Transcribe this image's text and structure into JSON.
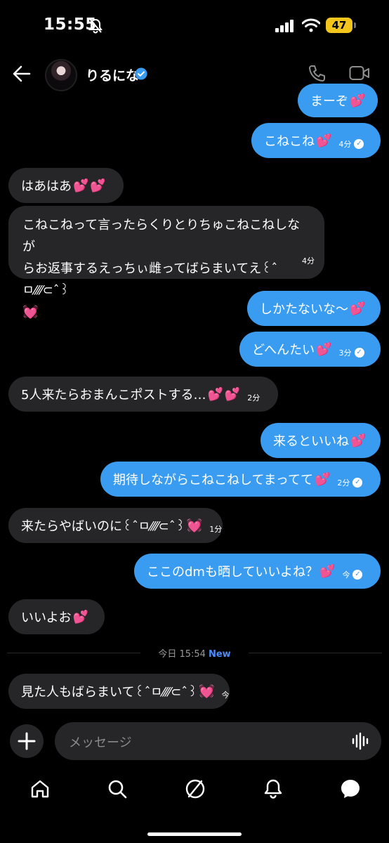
{
  "status_bar": {
    "time": "15:55",
    "battery": "47"
  },
  "header": {
    "contact_name": "りるにな"
  },
  "messages": [
    {
      "text": "まーぞ",
      "time": ""
    },
    {
      "text": "こねこね",
      "time": "4分"
    },
    {
      "text": "はあはあ",
      "time": ""
    },
    {
      "lines": [
        "こねこねって言ったらくりとりちゅこねこねしなが",
        "らお返事するえっちぃ雌ってばらまいてえ꒰ˆㅁ⁄⁄⁄⁄⊂ˆ꒱"
      ],
      "time": "4分"
    },
    {
      "text": "しかたないな〜",
      "time": ""
    },
    {
      "text": "どへんたい",
      "time": "3分"
    },
    {
      "text": "5人来たらおまんこポストする…",
      "time": "2分"
    },
    {
      "text": "来るといいね",
      "time": ""
    },
    {
      "text": "期待しながらこねこねしてまってて",
      "time": "2分"
    },
    {
      "text": "来たらやばいのに꒰ˆㅁ⁄⁄⁄⁄⊂ˆ꒱",
      "time": "1分"
    },
    {
      "text": "ここのdmも晒していいよね？",
      "time": "今"
    },
    {
      "text": "いいよお",
      "time": ""
    },
    {
      "text": "見た人もばらまいて꒰ˆㅁ⁄⁄⁄⁄⊂ˆ꒱",
      "time": "今"
    }
  ],
  "divider": {
    "label": "今日 15:54",
    "new_label": "New"
  },
  "composer": {
    "placeholder": "メッセージ"
  },
  "icons": {
    "heart": "💕",
    "heart_single": "💓",
    "back": "arrow-left-icon",
    "phone": "phone-icon",
    "video": "video-camera-icon",
    "plus": "plus-icon",
    "voice": "waveform-icon",
    "tabs": [
      "home-icon",
      "search-icon",
      "explore-icon",
      "bell-icon",
      "messages-icon"
    ]
  },
  "colors": {
    "outgoing": "#3a9cf0",
    "incoming": "#262628",
    "new": "#4c8cff",
    "battery": "#f4c51a"
  }
}
